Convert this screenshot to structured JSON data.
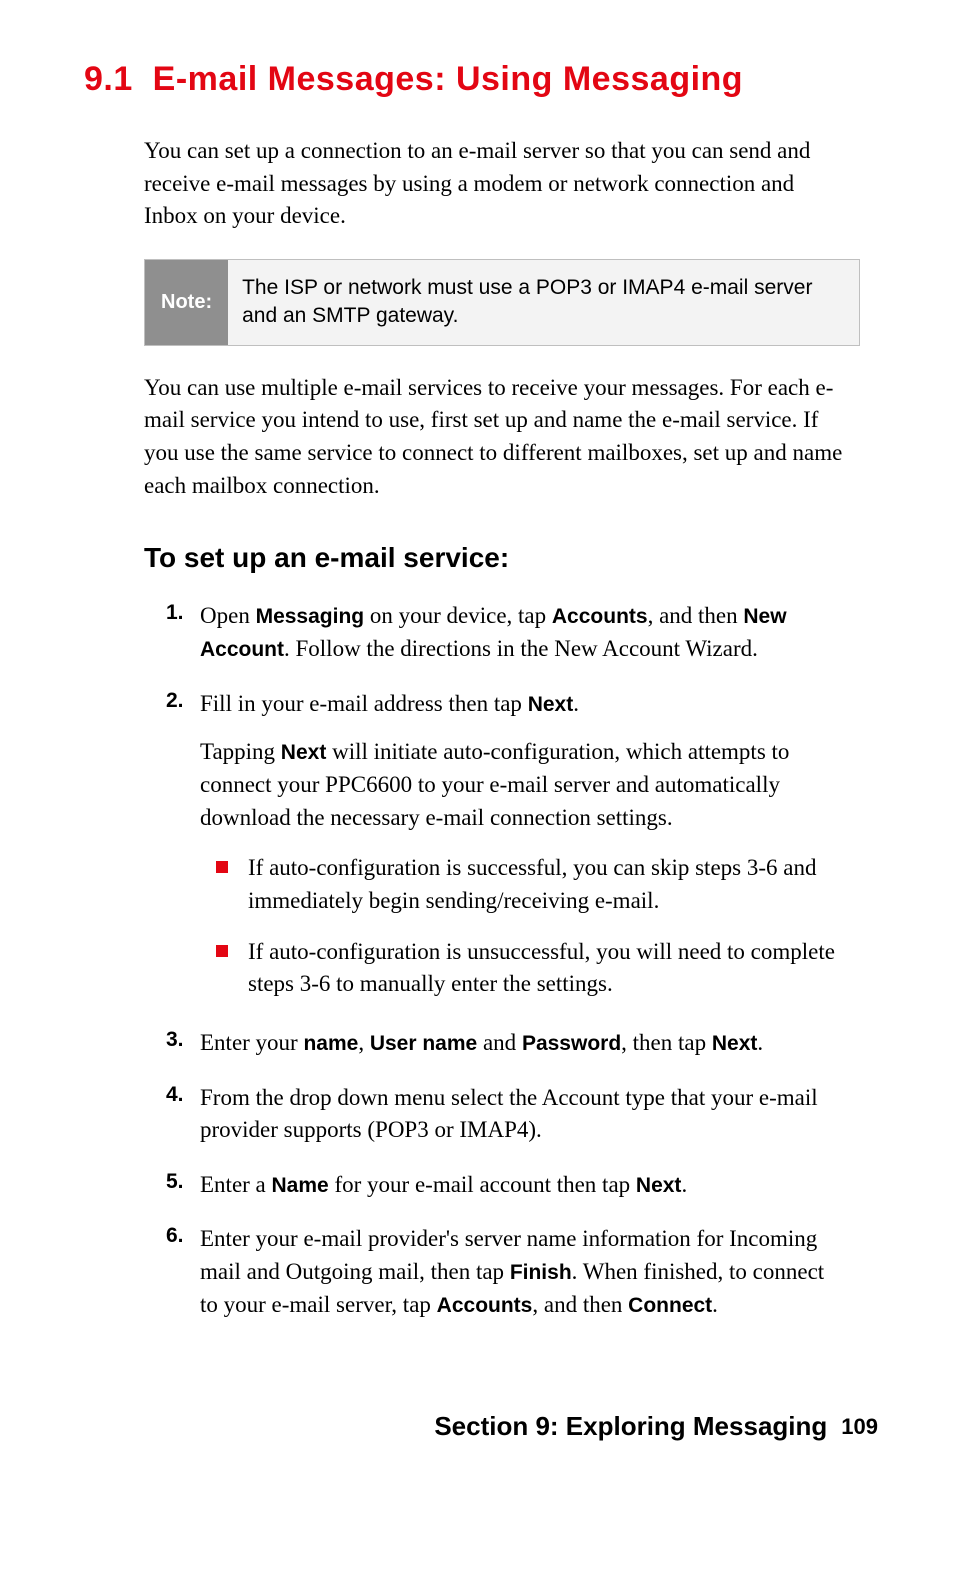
{
  "heading": {
    "number": "9.1",
    "title": "E-mail Messages: Using Messaging"
  },
  "intro": "You can set up a connection to an e-mail server so that you can send and receive e-mail messages by using a modem or network connection and Inbox on your device.",
  "note": {
    "label": "Note:",
    "text": "The ISP or network must use a POP3 or IMAP4 e-mail server and an SMTP gateway."
  },
  "para2": "You can use multiple e-mail services to receive your messages. For each e-mail service you intend to use, first set up and name the e-mail service. If you use the same service to connect to different mailboxes, set up and name each mailbox connection.",
  "subheading": "To set up an e-mail service:",
  "steps": {
    "s1": {
      "num": "1.",
      "t1": "Open ",
      "b1": "Messaging",
      "t2": " on your device, tap ",
      "b2": "Accounts",
      "t3": ", and then ",
      "b3": "New Account",
      "t4": ". Follow the directions in the New Account Wizard."
    },
    "s2": {
      "num": "2.",
      "line1_t1": "Fill in your e-mail address then tap ",
      "line1_b1": "Next",
      "line1_t2": ".",
      "line2_t1": "Tapping ",
      "line2_b1": "Next",
      "line2_t2": " will initiate auto-configuration, which attempts to connect your PPC6600 to your e-mail server and automatically download the necessary e-mail connection settings.",
      "bullet1": "If auto-configuration is successful, you can skip steps 3-6 and  immediately begin sending/receiving e-mail.",
      "bullet2": "If auto-configuration is unsuccessful, you will need to complete steps 3-6 to  manually enter the settings."
    },
    "s3": {
      "num": "3.",
      "t1": "Enter your ",
      "b1": "name",
      "t2": ", ",
      "b2": "User name",
      "t3": " and ",
      "b3": "Password",
      "t4": ", then tap ",
      "b4": "Next",
      "t5": "."
    },
    "s4": {
      "num": "4.",
      "text": "From the drop down menu select the Account type that your e-mail provider supports (POP3 or IMAP4)."
    },
    "s5": {
      "num": "5.",
      "t1": "Enter a ",
      "b1": "Name",
      "t2": " for your e-mail account then tap ",
      "b2": "Next",
      "t3": "."
    },
    "s6": {
      "num": "6.",
      "t1": "Enter your e-mail provider's server name information for Incoming mail and Outgoing mail, then tap ",
      "b1": "Finish",
      "t2": ". When finished, to connect to your e-mail server, tap ",
      "b2": "Accounts",
      "t3": ", and then ",
      "b3": "Connect",
      "t4": "."
    }
  },
  "footer": {
    "section": "Section 9: Exploring Messaging",
    "page": "109"
  }
}
